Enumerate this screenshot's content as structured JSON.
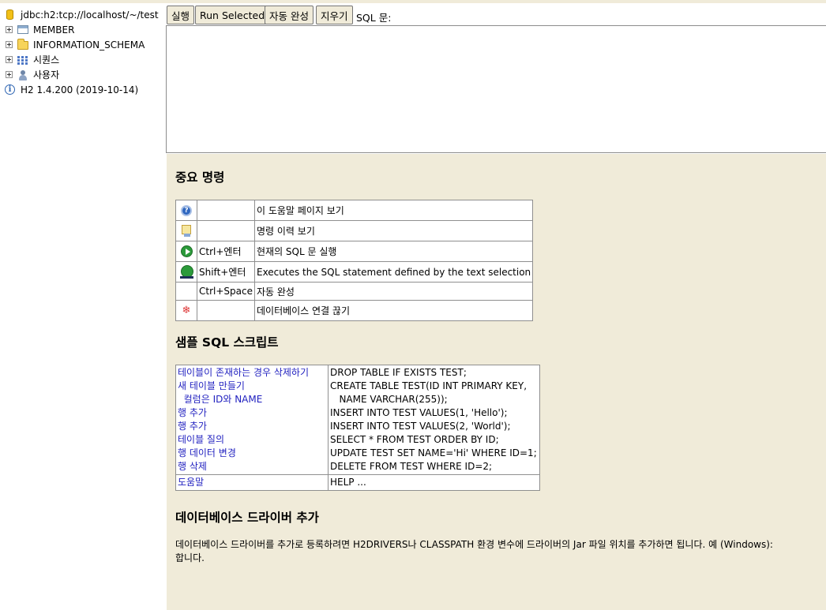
{
  "tree": {
    "connection": "jdbc:h2:tcp://localhost/~/test",
    "items": [
      {
        "label": "MEMBER",
        "icon": "table-icon"
      },
      {
        "label": "INFORMATION_SCHEMA",
        "icon": "folder-icon"
      },
      {
        "label": "시퀀스",
        "icon": "sequence-icon"
      },
      {
        "label": "사용자",
        "icon": "users-icon"
      }
    ],
    "version": "H2 1.4.200 (2019-10-14)"
  },
  "toolbar": {
    "run_label": "실행",
    "run_selected_label": "Run Selected",
    "autocomplete_label": "자동 완성",
    "clear_label": "지우기",
    "sql_label": "SQL 문:"
  },
  "editor": {
    "value": ""
  },
  "help": {
    "important_title": "중요 명령",
    "commands": [
      {
        "icon": "help-icon",
        "key": "",
        "desc": "이 도움말 페이지 보기"
      },
      {
        "icon": "history-icon",
        "key": "",
        "desc": "명령 이력 보기"
      },
      {
        "icon": "run-icon",
        "key": "Ctrl+엔터",
        "desc": "현재의 SQL 문 실행"
      },
      {
        "icon": "run-selected-icon",
        "key": "Shift+엔터",
        "desc": "Executes the SQL statement defined by the text selection"
      },
      {
        "icon": "",
        "key": "Ctrl+Space",
        "desc": "자동 완성"
      },
      {
        "icon": "disconnect-icon",
        "key": "",
        "desc": "데이터베이스 연결 끊기"
      }
    ],
    "sample_title": "샘플 SQL 스크립트",
    "samples": [
      {
        "label": "테이블이 존재하는 경우 삭제하기",
        "sql": "DROP TABLE IF EXISTS TEST;"
      },
      {
        "label": "새 테이블 만들기",
        "sql": "CREATE TABLE TEST(ID INT PRIMARY KEY,"
      },
      {
        "label": "  컬럼은 ID와 NAME",
        "sql": "   NAME VARCHAR(255));"
      },
      {
        "label": "행 추가",
        "sql": "INSERT INTO TEST VALUES(1, 'Hello');"
      },
      {
        "label": "행 추가",
        "sql": "INSERT INTO TEST VALUES(2, 'World');"
      },
      {
        "label": "테이블 질의",
        "sql": "SELECT * FROM TEST ORDER BY ID;"
      },
      {
        "label": "행 데이터 변경",
        "sql": "UPDATE TEST SET NAME='Hi' WHERE ID=1;"
      },
      {
        "label": "행 삭제",
        "sql": "DELETE FROM TEST WHERE ID=2;"
      }
    ],
    "help_row": {
      "label": "도움말",
      "sql": "HELP ..."
    },
    "driver_title": "데이터베이스 드라이버 추가",
    "driver_desc_1": "데이터베이스 드라이버를 추가로 등록하려면 H2DRIVERS나 CLASSPATH 환경 변수에 드라이버의 Jar 파일 위치를 추가하면 됩니다. 예 (Windows):",
    "driver_desc_2": "합니다."
  }
}
